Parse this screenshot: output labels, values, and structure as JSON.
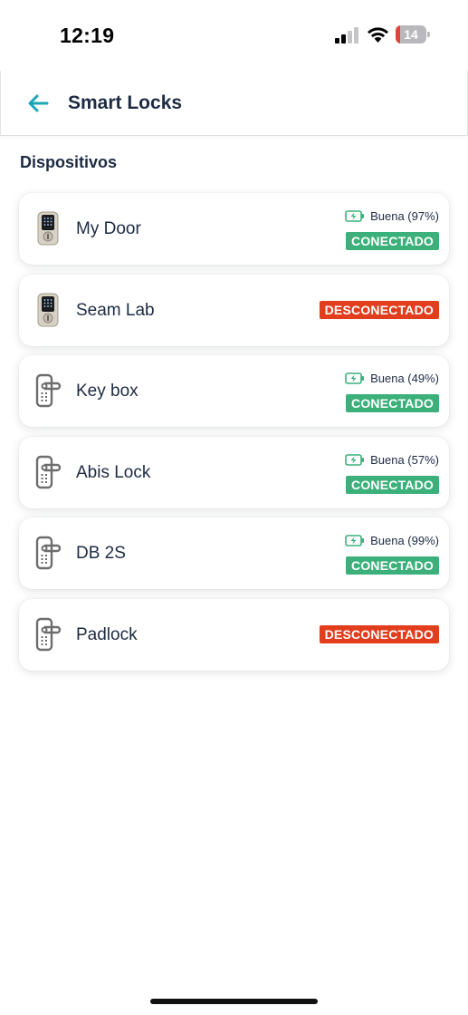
{
  "status_bar": {
    "time": "12:19",
    "battery_level": "14",
    "battery_fraction": 0.14
  },
  "header": {
    "title": "Smart Locks",
    "back_icon": "arrow-left-icon"
  },
  "section": {
    "title": "Dispositivos"
  },
  "colors": {
    "accent": "#1aa6b7",
    "connected": "#3cb07b",
    "disconnected": "#e23d1c",
    "text": "#1d2b44"
  },
  "devices": [
    {
      "name": "My Door",
      "icon": "keypad-deadbolt-icon",
      "battery": "Buena (97%)",
      "status": "CONECTADO",
      "connected": true
    },
    {
      "name": "Seam Lab",
      "icon": "keypad-deadbolt-icon",
      "battery": "",
      "status": "DESCONECTADO",
      "connected": false
    },
    {
      "name": "Key box",
      "icon": "lever-lock-icon",
      "battery": "Buena (49%)",
      "status": "CONECTADO",
      "connected": true
    },
    {
      "name": "Abis Lock",
      "icon": "lever-lock-icon",
      "battery": "Buena (57%)",
      "status": "CONECTADO",
      "connected": true
    },
    {
      "name": "DB 2S",
      "icon": "lever-lock-icon",
      "battery": "Buena (99%)",
      "status": "CONECTADO",
      "connected": true
    },
    {
      "name": "Padlock",
      "icon": "lever-lock-icon",
      "battery": "",
      "status": "DESCONECTADO",
      "connected": false
    }
  ]
}
